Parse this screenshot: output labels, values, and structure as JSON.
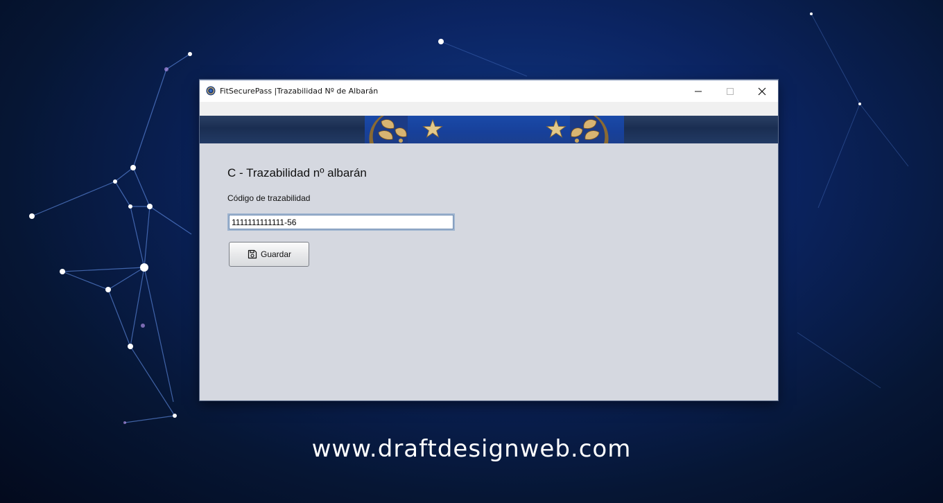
{
  "window": {
    "title": "FitSecurePass |Trazabilidad Nº de Albarán",
    "icons": [
      "app-globe-icon",
      "minimize-icon",
      "maximize-icon",
      "close-icon"
    ]
  },
  "main": {
    "heading": "C - Trazabilidad nº albarán",
    "field_label": "Código de trazabilidad",
    "field_value": "1111111111111-56",
    "save_label": "Guardar",
    "save_icon": "floppy-disk-icon"
  },
  "watermark": "www.draftdesignweb.com",
  "colors": {
    "content_bg": "#d5d8e0",
    "banner_blue": "#17409a",
    "desktop_bg": "#0b2462"
  }
}
